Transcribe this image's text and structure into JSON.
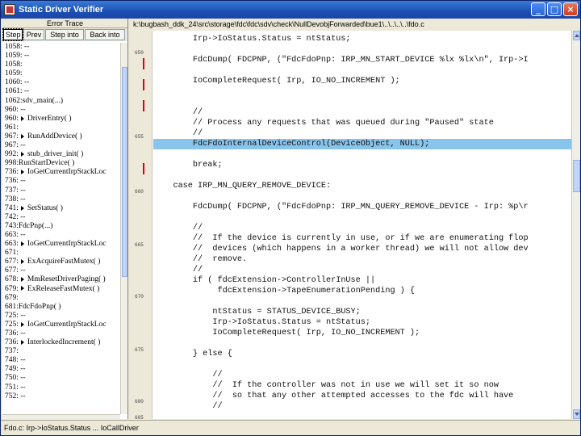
{
  "window": {
    "title": "Static Driver Verifier",
    "minimize": "_",
    "maximize": "□",
    "close": "×"
  },
  "trace_pane": {
    "header": "Error Trace",
    "buttons": [
      "Step",
      "Prev",
      "Step into",
      "Back into"
    ],
    "lines": [
      {
        "text": "1058: --",
        "arrow": false
      },
      {
        "text": "1059: --",
        "arrow": false
      },
      {
        "text": "1058:",
        "arrow": false
      },
      {
        "text": "1059:",
        "arrow": false
      },
      {
        "text": "1060: --",
        "arrow": false
      },
      {
        "text": "1061: --",
        "arrow": false
      },
      {
        "text": "1062:sdv_main(...)",
        "arrow": false
      },
      {
        "text": "960: --",
        "arrow": false
      },
      {
        "text": "960:",
        "arrow": true,
        "label": "DriverEntry( )"
      },
      {
        "text": "961:",
        "arrow": false
      },
      {
        "text": "967:",
        "arrow": true,
        "label": "RunAddDevice( )"
      },
      {
        "text": "967: --",
        "arrow": false
      },
      {
        "text": "992:",
        "arrow": true,
        "label": "stub_driver_init( )"
      },
      {
        "text": "998:RunStartDevice( )",
        "arrow": false
      },
      {
        "text": "736:",
        "arrow": true,
        "label": "IoGetCurrentIrpStackLoc"
      },
      {
        "text": "736: --",
        "arrow": false
      },
      {
        "text": "737: --",
        "arrow": false
      },
      {
        "text": "738: --",
        "arrow": false
      },
      {
        "text": "741:",
        "arrow": true,
        "label": "SetStatus( )"
      },
      {
        "text": "742: --",
        "arrow": false
      },
      {
        "text": "743:FdcPnp(...)",
        "arrow": false
      },
      {
        "text": "663: --",
        "arrow": false
      },
      {
        "text": "663:",
        "arrow": true,
        "label": "IoGetCurrentIrpStackLoc"
      },
      {
        "text": "671:",
        "arrow": false
      },
      {
        "text": "677:",
        "arrow": true,
        "label": "ExAcquireFastMutex( )"
      },
      {
        "text": "677: --",
        "arrow": false
      },
      {
        "text": "678:",
        "arrow": true,
        "label": "MmResetDriverPaging( )"
      },
      {
        "text": "679:",
        "arrow": true,
        "label": "ExReleaseFastMutex( )"
      },
      {
        "text": "679:",
        "arrow": false
      },
      {
        "text": "681:FdcFdoPnp( )",
        "arrow": false
      },
      {
        "text": "725: --",
        "arrow": false
      },
      {
        "text": "725:",
        "arrow": true,
        "label": "IoGetCurrentIrpStackLoc"
      },
      {
        "text": "736: --",
        "arrow": false
      },
      {
        "text": "736:",
        "arrow": true,
        "label": "InterlockedIncrement( )"
      },
      {
        "text": "737:",
        "arrow": false
      },
      {
        "text": "748: --",
        "arrow": false
      },
      {
        "text": "749: --",
        "arrow": false
      },
      {
        "text": "750: --",
        "arrow": false
      },
      {
        "text": "751: --",
        "arrow": false
      },
      {
        "text": "752: --",
        "arrow": false
      }
    ]
  },
  "editor": {
    "path": "k:\\bugbash_ddk_24\\src\\storage\\fdc\\fdc\\sdv\\check\\NullDevobjForwarded\\bue1\\..\\..\\..\\..\\fdo.c",
    "gutter_labels": [
      "650",
      "655",
      "660",
      "665",
      "670",
      "675",
      "680",
      "685"
    ],
    "lines": [
      {
        "text": "        Irp->IoStatus.Status = ntStatus;",
        "hl": false
      },
      {
        "text": "",
        "hl": false
      },
      {
        "text": "        FdcDump( FDCPNP, (\"FdcFdoPnp: IRP_MN_START_DEVICE %lx %lx\\n\", Irp->I",
        "hl": false
      },
      {
        "text": "",
        "hl": false
      },
      {
        "text": "        IoCompleteRequest( Irp, IO_NO_INCREMENT );",
        "hl": false
      },
      {
        "text": "",
        "hl": false
      },
      {
        "text": "",
        "hl": false
      },
      {
        "text": "        //",
        "hl": false
      },
      {
        "text": "        // Process any requests that was queued during \"Paused\" state",
        "hl": false
      },
      {
        "text": "        //",
        "hl": false
      },
      {
        "text": "        FdcFdoInternalDeviceControl(DeviceObject, NULL);",
        "hl": true
      },
      {
        "text": "",
        "hl": false
      },
      {
        "text": "        break;",
        "hl": false
      },
      {
        "text": "",
        "hl": false
      },
      {
        "text": "    case IRP_MN_QUERY_REMOVE_DEVICE:",
        "hl": false
      },
      {
        "text": "",
        "hl": false
      },
      {
        "text": "        FdcDump( FDCPNP, (\"FdcFdoPnp: IRP_MN_QUERY_REMOVE_DEVICE - Irp: %p\\r",
        "hl": false
      },
      {
        "text": "",
        "hl": false
      },
      {
        "text": "        //",
        "hl": false
      },
      {
        "text": "        //  If the device is currently in use, or if we are enumerating flop",
        "hl": false
      },
      {
        "text": "        //  devices (which happens in a worker thread) we will not allow dev",
        "hl": false
      },
      {
        "text": "        //  remove.",
        "hl": false
      },
      {
        "text": "        //",
        "hl": false
      },
      {
        "text": "        if ( fdcExtension->ControllerInUse ||",
        "hl": false
      },
      {
        "text": "             fdcExtension->TapeEnumerationPending ) {",
        "hl": false
      },
      {
        "text": "",
        "hl": false
      },
      {
        "text": "            ntStatus = STATUS_DEVICE_BUSY;",
        "hl": false
      },
      {
        "text": "            Irp->IoStatus.Status = ntStatus;",
        "hl": false
      },
      {
        "text": "            IoCompleteRequest( Irp, IO_NO_INCREMENT );",
        "hl": false
      },
      {
        "text": "",
        "hl": false
      },
      {
        "text": "        } else {",
        "hl": false
      },
      {
        "text": "",
        "hl": false
      },
      {
        "text": "            //",
        "hl": false
      },
      {
        "text": "            //  If the controller was not in use we will set it so now",
        "hl": false
      },
      {
        "text": "            //  so that any other attempted accesses to the fdc will have",
        "hl": false
      },
      {
        "text": "            //",
        "hl": false
      }
    ]
  },
  "status": {
    "text": "Fdo.c: Irp->IoStatus.Status ... IoCallDriver"
  }
}
